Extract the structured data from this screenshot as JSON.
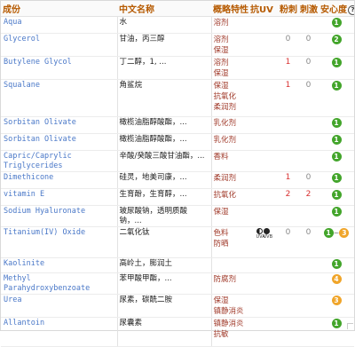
{
  "headers": {
    "ingredient": "成份",
    "chinese_name": "中文名称",
    "function": "概略特性",
    "uv": "抗UV",
    "acne": "粉刺",
    "irritant": "刺激",
    "safety": "安心度",
    "help": "?"
  },
  "rows": [
    {
      "name": "Aqua",
      "cn": "水",
      "func": [
        "溶剂"
      ],
      "acne": "",
      "irritant": "",
      "uv": "",
      "safety": [
        "1"
      ],
      "safety_colors": [
        "green"
      ]
    },
    {
      "name": "Glycerol",
      "cn": "甘油，丙三醇",
      "func": [
        "溶剂",
        "保湿"
      ],
      "acne": "0",
      "irritant": "0",
      "uv": "",
      "safety": [
        "2"
      ],
      "safety_colors": [
        "green"
      ]
    },
    {
      "name": "Butylene Glycol",
      "cn": "丁二醇，1, ...",
      "func": [
        "溶剂",
        "保湿"
      ],
      "acne": "1",
      "irritant": "0",
      "uv": "",
      "safety": [
        "1"
      ],
      "safety_colors": [
        "green"
      ]
    },
    {
      "name": "Squalane",
      "cn": "角鲨烷",
      "func": [
        "保湿",
        "抗氧化",
        "柔润剂"
      ],
      "acne": "1",
      "irritant": "0",
      "uv": "",
      "safety": [
        "1"
      ],
      "safety_colors": [
        "green"
      ]
    },
    {
      "name": "Sorbitan Olivate",
      "cn": "橄榄油脂醇酸酯，...",
      "func": [
        "乳化剂"
      ],
      "acne": "",
      "irritant": "",
      "uv": "",
      "safety": [
        "1"
      ],
      "safety_colors": [
        "green"
      ]
    },
    {
      "name": "Sorbitan Olivate",
      "cn": "橄榄油脂醇酸酯，...",
      "func": [
        "乳化剂"
      ],
      "acne": "",
      "irritant": "",
      "uv": "",
      "safety": [
        "1"
      ],
      "safety_colors": [
        "green"
      ]
    },
    {
      "name": "Capric/Caprylic Triglycerides",
      "cn": "辛酸/癸酸三酸甘油酯，...",
      "func": [
        "香料"
      ],
      "acne": "",
      "irritant": "",
      "uv": "",
      "safety": [
        "1"
      ],
      "safety_colors": [
        "green"
      ]
    },
    {
      "name": "Dimethicone",
      "cn": "硅灵，地美司康，...",
      "func": [
        "柔润剂"
      ],
      "acne": "1",
      "irritant": "0",
      "uv": "",
      "safety": [
        "1"
      ],
      "safety_colors": [
        "green"
      ]
    },
    {
      "name": "vitamin E",
      "cn": "生育酚，生育醇，...",
      "func": [
        "抗氧化"
      ],
      "acne": "2",
      "irritant": "2",
      "uv": "",
      "safety": [
        "1"
      ],
      "safety_colors": [
        "green"
      ]
    },
    {
      "name": "Sodium Hyaluronate",
      "cn": "玻尿酸钠，透明质酸钠，...",
      "func": [
        "保湿"
      ],
      "acne": "",
      "irritant": "",
      "uv": "",
      "safety": [
        "1"
      ],
      "safety_colors": [
        "green"
      ]
    },
    {
      "name": "Titanium(IV) Oxide",
      "cn": "二氧化钛",
      "func": [
        "色料",
        "防晒"
      ],
      "acne": "0",
      "irritant": "0",
      "uv": "UVA UVB",
      "safety": [
        "1",
        "3"
      ],
      "safety_colors": [
        "green",
        "orange"
      ]
    },
    {
      "name": "Kaolinite",
      "cn": "高岭土，膨润土",
      "func": [],
      "acne": "",
      "irritant": "",
      "uv": "",
      "safety": [
        "1"
      ],
      "safety_colors": [
        "green"
      ]
    },
    {
      "name": "Methyl Parahydroxybenzoate",
      "cn": "苯甲酸甲酯，...",
      "func": [
        "防腐剂"
      ],
      "acne": "",
      "irritant": "",
      "uv": "",
      "safety": [
        "4"
      ],
      "safety_colors": [
        "orange"
      ]
    },
    {
      "name": "Urea",
      "cn": "尿素，碳酰二胺",
      "func": [
        "保湿",
        "镇静消炎"
      ],
      "acne": "",
      "irritant": "",
      "uv": "",
      "safety": [
        "3"
      ],
      "safety_colors": [
        "orange"
      ]
    },
    {
      "name": "Allantoin",
      "cn": "尿囊素",
      "func": [
        "镇静消炎",
        "抗敏"
      ],
      "acne": "",
      "irritant": "",
      "uv": "",
      "safety": [
        "1"
      ],
      "safety_colors": [
        "green"
      ]
    }
  ]
}
